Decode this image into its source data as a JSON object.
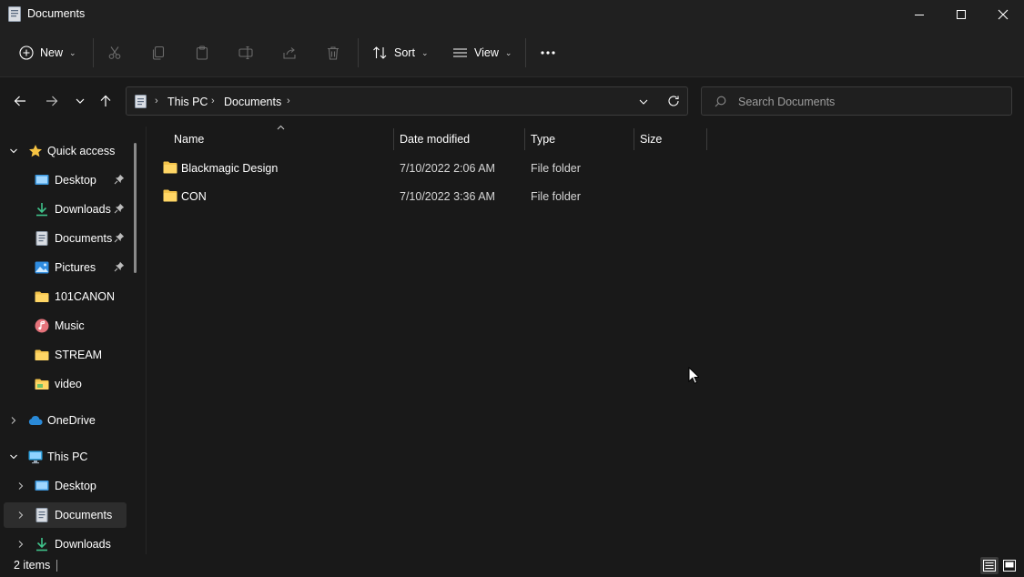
{
  "window": {
    "title": "Documents"
  },
  "toolbar": {
    "new_label": "New",
    "sort_label": "Sort",
    "view_label": "View"
  },
  "address": {
    "crumbs": [
      "This PC",
      "Documents"
    ]
  },
  "search": {
    "placeholder": "Search Documents"
  },
  "sidebar": {
    "quick_access": "Quick access",
    "quick_items": [
      "Desktop",
      "Downloads",
      "Documents",
      "Pictures",
      "101CANON",
      "Music",
      "STREAM",
      "video"
    ],
    "onedrive": "OneDrive",
    "this_pc": "This PC",
    "pc_items": [
      "Desktop",
      "Documents",
      "Downloads"
    ]
  },
  "columns": {
    "name": "Name",
    "date": "Date modified",
    "type": "Type",
    "size": "Size"
  },
  "files": [
    {
      "name": "Blackmagic Design",
      "date": "7/10/2022 2:06 AM",
      "type": "File folder",
      "size": ""
    },
    {
      "name": "CON",
      "date": "7/10/2022 3:36 AM",
      "type": "File folder",
      "size": ""
    }
  ],
  "status": {
    "count": "2 items"
  },
  "colors": {
    "folder": "#f3c34b",
    "accent": "#60cdff",
    "background": "#191919",
    "chrome": "#202020"
  }
}
